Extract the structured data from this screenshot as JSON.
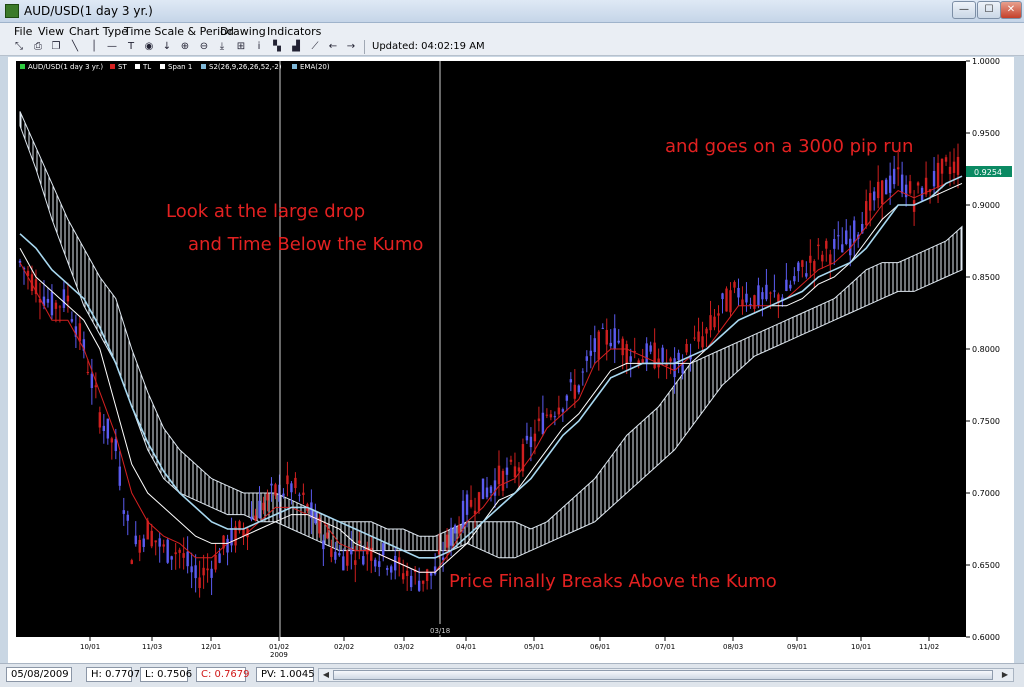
{
  "window": {
    "title": "AUD/USD(1 day  3 yr.)",
    "minimize": "—",
    "maximize": "☐",
    "close": "✕"
  },
  "menu": [
    "File",
    "View",
    "Chart Type",
    "Time Scale & Period",
    "Drawing",
    "Indicators"
  ],
  "toolbar": {
    "icons": [
      "cursor-icon",
      "print-icon",
      "copy-icon",
      "line-icon",
      "vertical-line-icon",
      "horizontal-line-icon",
      "text-icon",
      "circle-icon",
      "down-arrow-icon",
      "zoom-in-icon",
      "zoom-out-icon",
      "download-icon",
      "fit-icon",
      "info-icon",
      "bars-icon",
      "bar-chart-icon",
      "line-chart-icon",
      "back-icon",
      "forward-icon"
    ],
    "glyphs": [
      "⤡",
      "⎙",
      "❐",
      "╲",
      "│",
      "—",
      "T",
      "◉",
      "↓",
      "⊕",
      "⊖",
      "⤓",
      "⊞",
      "i",
      "▚",
      "▟",
      "⟋",
      "←",
      "→"
    ],
    "updated": "Updated: 04:02:19 AM"
  },
  "legend": [
    {
      "label": "AUD/USD(1 day  3 yr.)",
      "color": "#2ecc40"
    },
    {
      "label": "ST",
      "color": "#d62020"
    },
    {
      "label": "TL",
      "color": "#ffffff"
    },
    {
      "label": "Span 1",
      "color": "#ffffff"
    },
    {
      "label": "S2(26,9,26,26,52,-2)",
      "color": "#7fb8d8"
    },
    {
      "label": "EMA(20)",
      "color": "#7fb8d8"
    }
  ],
  "annotations": {
    "drop1": "Look at the large drop",
    "drop2": "and Time Below the Kumo",
    "run": "and goes on a 3000 pip run",
    "breakout": "Price Finally Breaks Above the Kumo"
  },
  "colors": {
    "background": "#000000",
    "annotation": "#e32121",
    "candle_up": "#5b5bf0",
    "candle_down": "#cf1f1f",
    "tenkan": "#d62020",
    "kijun": "#ffffff",
    "ema": "#a8d8f0",
    "cloud": "#dfe8f0",
    "price_marker": "#0b8a63"
  },
  "chart_data": {
    "type": "candlestick",
    "symbol": "AUD/USD",
    "period": "1 day",
    "ylim": [
      0.6,
      1.0
    ],
    "y_ticks": [
      "1.0000",
      "0.9500",
      "0.9000",
      "0.8500",
      "0.8000",
      "0.7500",
      "0.7000",
      "0.6500",
      "0.6000"
    ],
    "x_ticks": [
      "10/01",
      "11/03",
      "12/01",
      "01/02",
      "02/02",
      "03/02",
      "04/01",
      "05/01",
      "06/01",
      "07/01",
      "08/03",
      "09/01",
      "10/01",
      "11/02"
    ],
    "year_label": "2009",
    "cursor_label": "03/18",
    "last_price": "0.9254",
    "last_price_value": 0.9254,
    "price_path": [
      [
        "08/20",
        0.86
      ],
      [
        "09/01",
        0.845
      ],
      [
        "09/10",
        0.83
      ],
      [
        "09/20",
        0.835
      ],
      [
        "10/01",
        0.8
      ],
      [
        "10/08",
        0.755
      ],
      [
        "10/16",
        0.73
      ],
      [
        "10/24",
        0.66
      ],
      [
        "11/01",
        0.675
      ],
      [
        "11/07",
        0.66
      ],
      [
        "11/14",
        0.66
      ],
      [
        "11/21",
        0.64
      ],
      [
        "12/01",
        0.65
      ],
      [
        "12/08",
        0.665
      ],
      [
        "12/15",
        0.675
      ],
      [
        "12/22",
        0.69
      ],
      [
        "01/01",
        0.7
      ],
      [
        "01/08",
        0.705
      ],
      [
        "01/15",
        0.69
      ],
      [
        "01/22",
        0.67
      ],
      [
        "02/01",
        0.655
      ],
      [
        "02/08",
        0.66
      ],
      [
        "02/15",
        0.66
      ],
      [
        "02/22",
        0.655
      ],
      [
        "03/01",
        0.645
      ],
      [
        "03/08",
        0.64
      ],
      [
        "03/15",
        0.645
      ],
      [
        "03/22",
        0.67
      ],
      [
        "04/01",
        0.69
      ],
      [
        "04/08",
        0.7
      ],
      [
        "04/15",
        0.71
      ],
      [
        "04/22",
        0.715
      ],
      [
        "05/01",
        0.735
      ],
      [
        "05/08",
        0.755
      ],
      [
        "05/15",
        0.765
      ],
      [
        "05/22",
        0.775
      ],
      [
        "06/01",
        0.8
      ],
      [
        "06/08",
        0.81
      ],
      [
        "06/15",
        0.8
      ],
      [
        "06/22",
        0.795
      ],
      [
        "07/01",
        0.795
      ],
      [
        "07/08",
        0.785
      ],
      [
        "07/15",
        0.8
      ],
      [
        "07/22",
        0.81
      ],
      [
        "08/01",
        0.83
      ],
      [
        "08/08",
        0.84
      ],
      [
        "08/15",
        0.835
      ],
      [
        "08/22",
        0.835
      ],
      [
        "09/01",
        0.84
      ],
      [
        "09/08",
        0.855
      ],
      [
        "09/15",
        0.865
      ],
      [
        "09/22",
        0.87
      ],
      [
        "10/01",
        0.875
      ],
      [
        "10/08",
        0.895
      ],
      [
        "10/15",
        0.91
      ],
      [
        "10/22",
        0.92
      ],
      [
        "11/01",
        0.905
      ],
      [
        "11/08",
        0.915
      ],
      [
        "11/15",
        0.925
      ],
      [
        "11/20",
        0.93
      ]
    ],
    "candles": [
      0.86,
      0.845,
      0.83,
      0.835,
      0.8,
      0.755,
      0.73,
      0.66,
      0.675,
      0.66,
      0.66,
      0.64,
      0.65,
      0.665,
      0.675,
      0.69,
      0.7,
      0.705,
      0.69,
      0.67,
      0.655,
      0.66,
      0.66,
      0.655,
      0.645,
      0.64,
      0.645,
      0.67,
      0.69,
      0.7,
      0.71,
      0.715,
      0.735,
      0.755,
      0.765,
      0.775,
      0.8,
      0.81,
      0.8,
      0.795,
      0.795,
      0.785,
      0.8,
      0.81,
      0.83,
      0.84,
      0.835,
      0.835,
      0.84,
      0.855,
      0.865,
      0.87,
      0.875,
      0.895,
      0.91,
      0.92,
      0.905,
      0.915,
      0.925,
      0.93
    ],
    "ema": [
      0.88,
      0.87,
      0.855,
      0.845,
      0.835,
      0.815,
      0.79,
      0.76,
      0.735,
      0.715,
      0.7,
      0.69,
      0.68,
      0.675,
      0.675,
      0.68,
      0.685,
      0.69,
      0.69,
      0.685,
      0.68,
      0.675,
      0.67,
      0.665,
      0.66,
      0.655,
      0.655,
      0.66,
      0.67,
      0.68,
      0.69,
      0.7,
      0.71,
      0.725,
      0.74,
      0.75,
      0.765,
      0.78,
      0.785,
      0.79,
      0.79,
      0.79,
      0.795,
      0.8,
      0.81,
      0.82,
      0.825,
      0.83,
      0.835,
      0.84,
      0.85,
      0.855,
      0.86,
      0.87,
      0.885,
      0.9,
      0.9,
      0.905,
      0.915,
      0.92
    ],
    "tenkan": [
      0.86,
      0.84,
      0.82,
      0.82,
      0.8,
      0.77,
      0.74,
      0.7,
      0.68,
      0.67,
      0.665,
      0.655,
      0.655,
      0.665,
      0.67,
      0.68,
      0.69,
      0.69,
      0.685,
      0.68,
      0.665,
      0.66,
      0.66,
      0.655,
      0.65,
      0.645,
      0.645,
      0.66,
      0.68,
      0.69,
      0.705,
      0.71,
      0.725,
      0.745,
      0.755,
      0.765,
      0.79,
      0.8,
      0.8,
      0.795,
      0.79,
      0.785,
      0.795,
      0.8,
      0.815,
      0.83,
      0.83,
      0.83,
      0.835,
      0.845,
      0.855,
      0.86,
      0.87,
      0.885,
      0.9,
      0.91,
      0.905,
      0.91,
      0.915,
      0.92
    ],
    "kijun": [
      0.87,
      0.85,
      0.84,
      0.83,
      0.82,
      0.8,
      0.76,
      0.72,
      0.7,
      0.69,
      0.68,
      0.67,
      0.665,
      0.665,
      0.67,
      0.675,
      0.68,
      0.685,
      0.685,
      0.68,
      0.675,
      0.665,
      0.66,
      0.655,
      0.65,
      0.645,
      0.645,
      0.655,
      0.665,
      0.68,
      0.695,
      0.7,
      0.715,
      0.73,
      0.745,
      0.755,
      0.77,
      0.785,
      0.79,
      0.79,
      0.79,
      0.79,
      0.79,
      0.8,
      0.81,
      0.82,
      0.825,
      0.83,
      0.83,
      0.835,
      0.845,
      0.85,
      0.86,
      0.875,
      0.89,
      0.9,
      0.9,
      0.905,
      0.91,
      0.915
    ],
    "cloud_top": [
      0.965,
      0.94,
      0.915,
      0.89,
      0.87,
      0.85,
      0.835,
      0.8,
      0.77,
      0.745,
      0.73,
      0.72,
      0.71,
      0.705,
      0.7,
      0.7,
      0.7,
      0.695,
      0.69,
      0.685,
      0.68,
      0.68,
      0.68,
      0.675,
      0.675,
      0.67,
      0.67,
      0.675,
      0.68,
      0.68,
      0.68,
      0.68,
      0.675,
      0.68,
      0.69,
      0.7,
      0.71,
      0.725,
      0.74,
      0.75,
      0.76,
      0.775,
      0.79,
      0.795,
      0.8,
      0.805,
      0.81,
      0.815,
      0.82,
      0.825,
      0.83,
      0.835,
      0.845,
      0.855,
      0.86,
      0.86,
      0.865,
      0.87,
      0.875,
      0.885
    ],
    "cloud_bottom": [
      0.955,
      0.925,
      0.89,
      0.86,
      0.83,
      0.81,
      0.79,
      0.76,
      0.73,
      0.71,
      0.7,
      0.695,
      0.69,
      0.685,
      0.685,
      0.68,
      0.68,
      0.675,
      0.67,
      0.665,
      0.66,
      0.66,
      0.66,
      0.66,
      0.66,
      0.66,
      0.66,
      0.66,
      0.665,
      0.66,
      0.655,
      0.655,
      0.66,
      0.665,
      0.67,
      0.675,
      0.68,
      0.69,
      0.7,
      0.71,
      0.72,
      0.73,
      0.745,
      0.76,
      0.775,
      0.785,
      0.795,
      0.8,
      0.805,
      0.81,
      0.815,
      0.82,
      0.825,
      0.83,
      0.835,
      0.84,
      0.84,
      0.845,
      0.85,
      0.855
    ]
  },
  "status": {
    "date": "05/08/2009",
    "high": "H: 0.7707",
    "low": "L: 0.7506",
    "close": "C: 0.7679",
    "pv": "PV: 1.0045"
  }
}
